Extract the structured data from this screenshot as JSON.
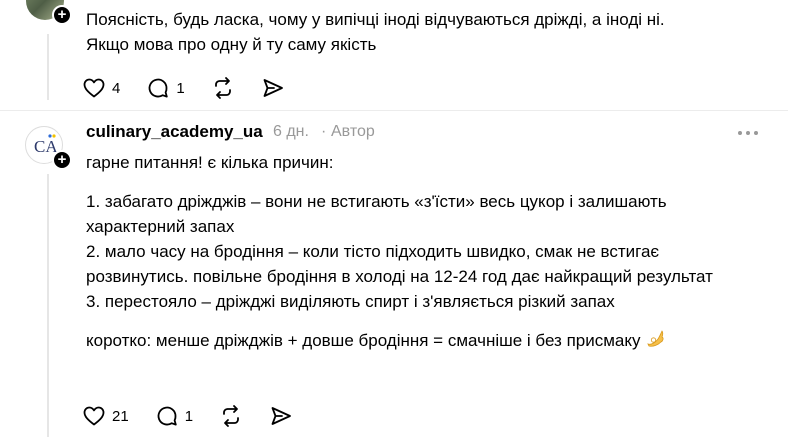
{
  "post1": {
    "text_line1": "Поясність, будь ласка, чому у випічці іноді відчуваються дріжді, а іноді ні.",
    "text_line2": "Якщо мова про одну й ту саму якість",
    "likes": "4",
    "replies": "1"
  },
  "post2": {
    "username": "culinary_academy_ua",
    "time": "6 дн.",
    "separator": "·",
    "role": "Автор",
    "avatar_initials": "CA",
    "intro": "гарне питання! є кілька причин:",
    "items": [
      "1. забагато дріжджів – вони не встигають «з'їсти» весь цукор і залишають характерний запах",
      "2. мало часу на бродіння – коли тісто підходить швидко, смак не встигає розвинутись. повільне бродіння в холоді на 12-24 год дає найкращий результат",
      "3. перестояло – дріжджі виділяють спирт і з'являється різкий запах"
    ],
    "summary": "коротко: менше дріжджів + довше бродіння = смачніше і без присмаку",
    "likes": "21",
    "replies": "1"
  },
  "icons": {
    "like": "heart-icon",
    "reply": "comment-icon",
    "repost": "repost-icon",
    "share": "send-icon",
    "more": "more-dots-icon",
    "plus": "plus-icon",
    "emoji": "ok-hand-emoji"
  },
  "colors": {
    "text": "#000000",
    "muted": "#999999",
    "thread_line": "#e6e6e6"
  }
}
